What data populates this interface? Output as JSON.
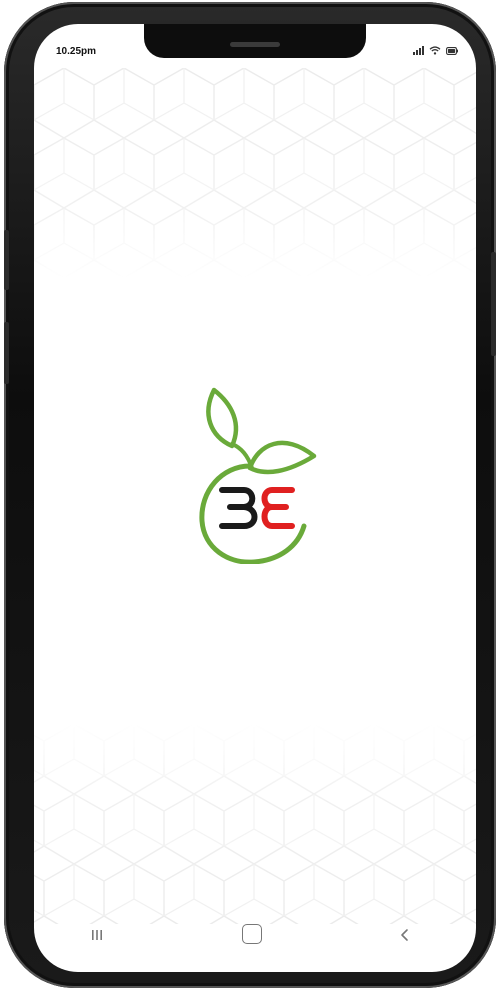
{
  "status_bar": {
    "time": "10.25pm",
    "signal_icon": "signal-icon",
    "wifi_icon": "wifi-icon",
    "battery_icon": "battery-icon"
  },
  "splash": {
    "logo_icon": "be-leaf-logo",
    "logo_text": "BE",
    "colors": {
      "leaf_green": "#6aaa3a",
      "letter_b": "#1a1a1a",
      "letter_e": "#e02020",
      "background": "#ffffff",
      "pattern": "#ebebeb"
    }
  },
  "nav_bar": {
    "recents_icon": "recents-icon",
    "home_icon": "home-icon",
    "back_icon": "back-icon"
  }
}
